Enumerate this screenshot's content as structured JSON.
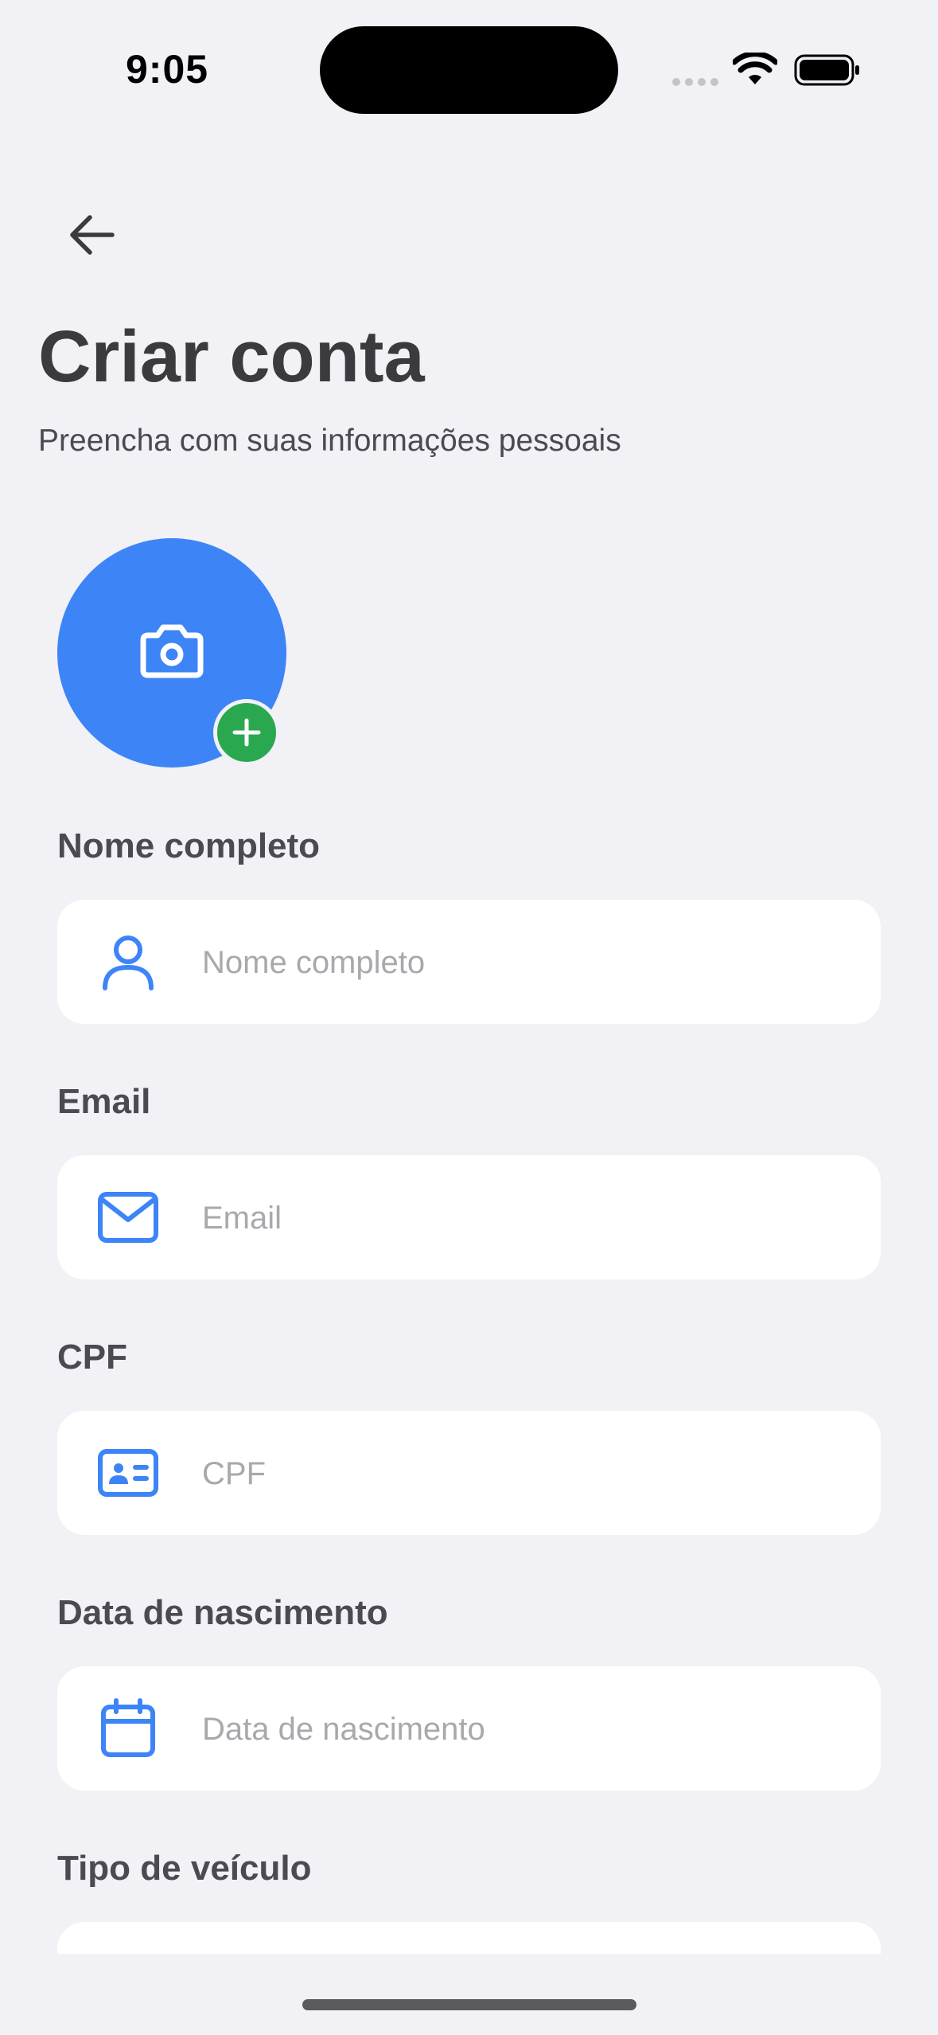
{
  "status_bar": {
    "time": "9:05"
  },
  "header": {
    "back_icon": "arrow-left-icon",
    "title": "Criar conta",
    "subtitle": "Preencha com suas informações pessoais"
  },
  "avatar": {
    "icon": "camera-icon",
    "badge_icon": "plus-icon",
    "color": "#3d84f7",
    "badge_color": "#2aa84f"
  },
  "form": {
    "full_name": {
      "label": "Nome completo",
      "placeholder": "Nome completo",
      "icon": "user-icon"
    },
    "email": {
      "label": "Email",
      "placeholder": "Email",
      "icon": "mail-icon"
    },
    "cpf": {
      "label": "CPF",
      "placeholder": "CPF",
      "icon": "id-card-icon"
    },
    "birth_date": {
      "label": "Data de nascimento",
      "placeholder": "Data de nascimento",
      "icon": "calendar-icon"
    },
    "vehicle_type": {
      "label": "Tipo de veículo"
    }
  },
  "colors": {
    "accent": "#3d84f7",
    "background": "#f1f1f6",
    "success": "#2aa84f"
  }
}
